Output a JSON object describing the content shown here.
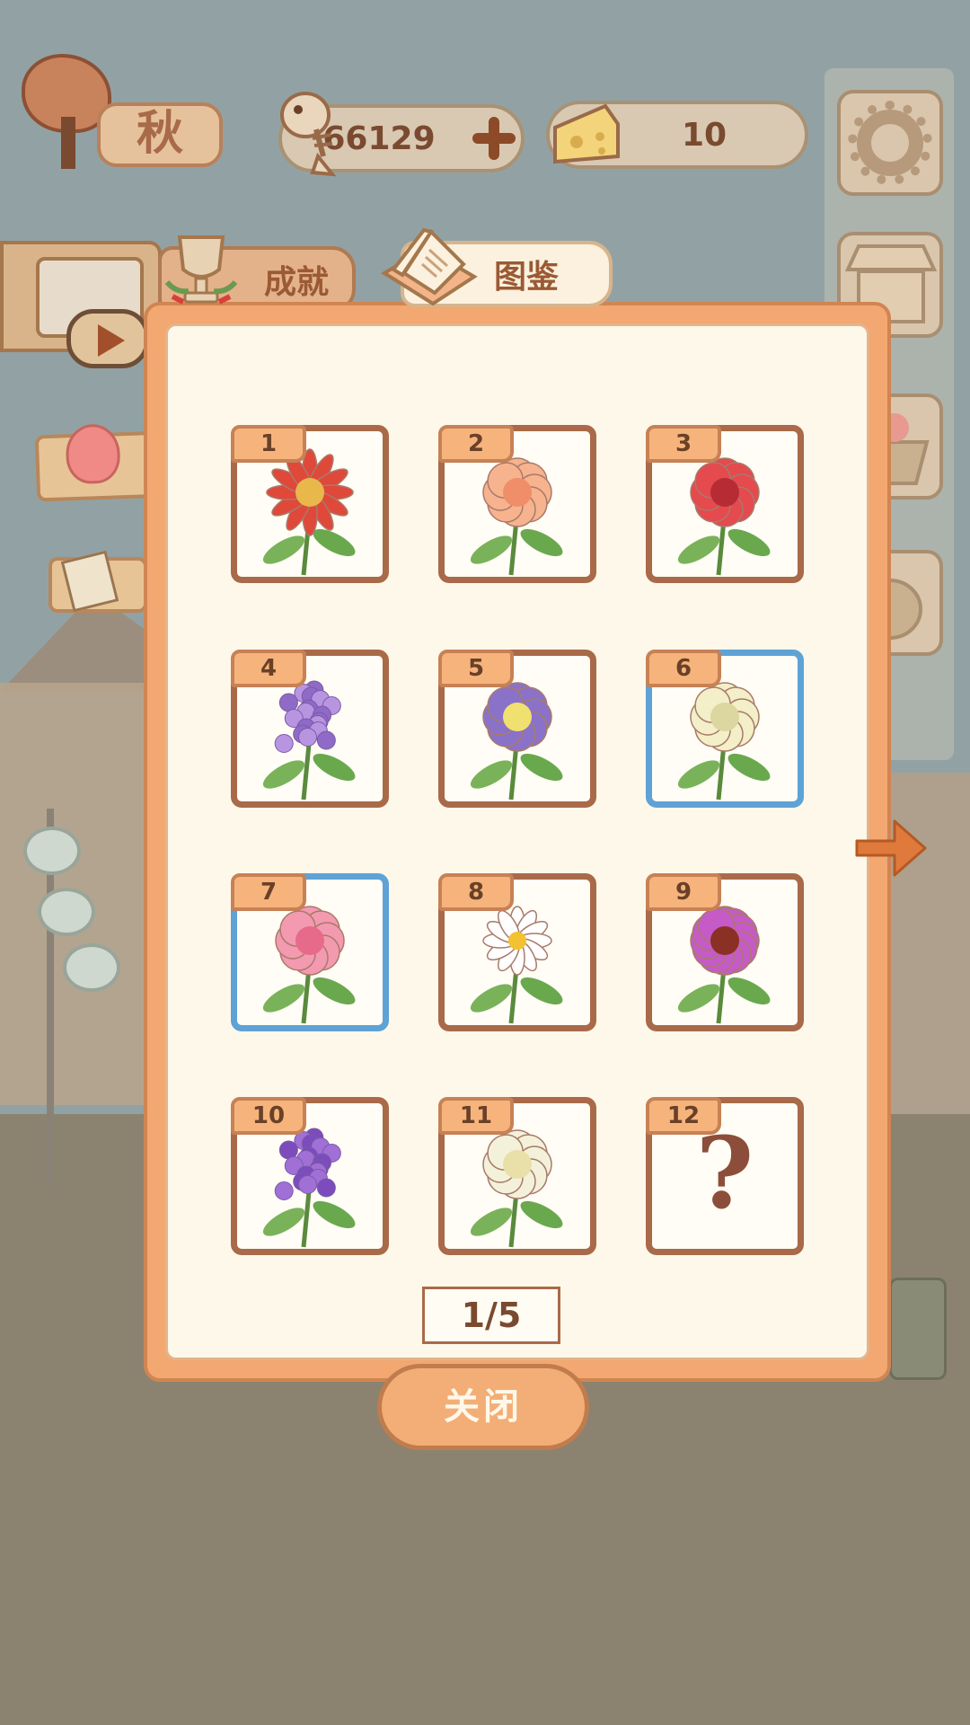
{
  "hud": {
    "season": "秋",
    "fish_count": "66129",
    "cheese_count": "10"
  },
  "tabs": {
    "achievements": "成就",
    "collection": "图鉴"
  },
  "collection": {
    "items": [
      {
        "number": "1",
        "flower": "spider-lily",
        "petal": "#e0483a",
        "center": "#e9b84a",
        "frame": "brown"
      },
      {
        "number": "2",
        "flower": "peach-rose",
        "petal": "#f6b38e",
        "center": "#f08e6a",
        "frame": "brown"
      },
      {
        "number": "3",
        "flower": "red-rose",
        "petal": "#e44a4e",
        "center": "#b72c34",
        "frame": "brown"
      },
      {
        "number": "4",
        "flower": "hyacinth",
        "petal": "#b895e0",
        "center": "#8f6ac6",
        "frame": "brown"
      },
      {
        "number": "5",
        "flower": "pansy",
        "petal": "#8a72c8",
        "center": "#f0e070",
        "frame": "brown"
      },
      {
        "number": "6",
        "flower": "gardenia",
        "petal": "#f3efc8",
        "center": "#dcd6a0",
        "frame": "blue"
      },
      {
        "number": "7",
        "flower": "peony",
        "petal": "#f39ab0",
        "center": "#e86a8a",
        "frame": "blue"
      },
      {
        "number": "8",
        "flower": "daisy",
        "petal": "#ffffff",
        "center": "#f2c230",
        "frame": "brown"
      },
      {
        "number": "9",
        "flower": "cosmos",
        "petal": "#c65ac6",
        "center": "#8a3024",
        "frame": "brown"
      },
      {
        "number": "10",
        "flower": "lilac",
        "petal": "#a070d6",
        "center": "#7c4cbc",
        "frame": "brown"
      },
      {
        "number": "11",
        "flower": "white-camellia",
        "petal": "#f4f1da",
        "center": "#e8e0a8",
        "frame": "brown"
      },
      {
        "number": "12",
        "flower": "unknown",
        "symbol": "?",
        "frame": "brown"
      }
    ],
    "page": "1/5",
    "close_label": "关闭"
  },
  "colors": {
    "dialog_frame": "#f3a771",
    "dialog_bg": "#fdf8e9",
    "cell_border": "#a96a4a",
    "cell_border_new": "#5fa2d6",
    "accent": "#e07a3c"
  },
  "icons": {
    "fish": "fish-bone-icon",
    "plus": "plus-icon",
    "cheese": "cheese-icon",
    "settings": "gear-icon",
    "shop": "shop-icon",
    "basket": "basket-icon",
    "bag": "bag-icon",
    "next": "arrow-right-icon",
    "trophy": "trophy-icon",
    "book": "book-icon"
  }
}
